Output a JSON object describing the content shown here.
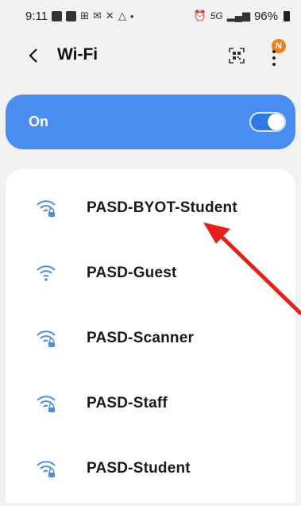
{
  "status_bar": {
    "time": "9:11",
    "network_type": "5G",
    "battery": "96%"
  },
  "header": {
    "back_icon": "chevron-left-icon",
    "title": "Wi-Fi",
    "qr_icon": "qr-scan-icon",
    "more_icon": "more-vertical-icon",
    "notification_badge": "N"
  },
  "wifi_toggle": {
    "label": "On",
    "state": true
  },
  "networks": [
    {
      "name": "PASD-BYOT-Student",
      "secured": true
    },
    {
      "name": "PASD-Guest",
      "secured": false
    },
    {
      "name": "PASD-Scanner",
      "secured": true
    },
    {
      "name": "PASD-Staff",
      "secured": true
    },
    {
      "name": "PASD-Student",
      "secured": true
    }
  ],
  "colors": {
    "accent": "#4a8df0",
    "wifi_icon": "#4a90e2",
    "annotation_arrow": "#e8201c",
    "badge": "#f07f1e",
    "background": "#f2f2f2"
  }
}
